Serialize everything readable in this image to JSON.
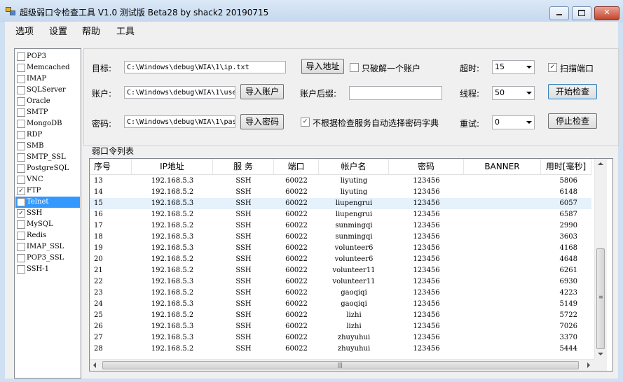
{
  "window": {
    "title": "超级弱口令检查工具 V1.0 测试版 Beta28 by shack2 20190715",
    "minimize_icon": "minimize-icon",
    "maximize_icon": "maximize-icon",
    "close_icon": "close-icon",
    "close_label": "✕"
  },
  "menu": [
    "选项",
    "设置",
    "帮助",
    "工具"
  ],
  "services": [
    {
      "name": "POP3",
      "checked": false
    },
    {
      "name": "Memcached",
      "checked": false
    },
    {
      "name": "IMAP",
      "checked": false
    },
    {
      "name": "SQLServer",
      "checked": false
    },
    {
      "name": "Oracle",
      "checked": false
    },
    {
      "name": "SMTP",
      "checked": false
    },
    {
      "name": "MongoDB",
      "checked": false
    },
    {
      "name": "RDP",
      "checked": false
    },
    {
      "name": "SMB",
      "checked": false
    },
    {
      "name": "SMTP_SSL",
      "checked": false
    },
    {
      "name": "PostgreSQL",
      "checked": false
    },
    {
      "name": "VNC",
      "checked": false
    },
    {
      "name": "FTP",
      "checked": true
    },
    {
      "name": "Telnet",
      "checked": false,
      "selected": true
    },
    {
      "name": "SSH",
      "checked": true
    },
    {
      "name": "MySQL",
      "checked": false
    },
    {
      "name": "Redis",
      "checked": false
    },
    {
      "name": "IMAP_SSL",
      "checked": false
    },
    {
      "name": "POP3_SSL",
      "checked": false
    },
    {
      "name": "SSH-1",
      "checked": false
    }
  ],
  "form": {
    "target_label": "目标:",
    "target_value": "C:\\Windows\\debug\\WIA\\1\\ip.txt",
    "import_address": "导入地址",
    "only_one_account": "只破解一个账户",
    "only_one_checked": false,
    "timeout_label": "超时:",
    "timeout_value": "15",
    "scan_port": "扫描端口",
    "scan_port_checked": true,
    "account_label": "账户:",
    "account_value": "C:\\Windows\\debug\\WIA\\1\\use",
    "import_account": "导入账户",
    "account_suffix_label": "账户后缀:",
    "account_suffix_value": "",
    "threads_label": "线程:",
    "threads_value": "50",
    "start_check": "开始检查",
    "password_label": "密码:",
    "password_value": "C:\\Windows\\debug\\WIA\\1\\pas",
    "import_password": "导入密码",
    "auto_dict": "不根据检查服务自动选择密码字典",
    "auto_dict_checked": true,
    "retry_label": "重试:",
    "retry_value": "0",
    "stop_check": "停止检查"
  },
  "list": {
    "title": "弱口令列表",
    "columns": [
      "序号",
      "IP地址",
      "服 务",
      "端口",
      "帐户名",
      "密码",
      "BANNER",
      "用时[毫秒]"
    ],
    "highlight_index": 2,
    "rows": [
      [
        "13",
        "192.168.5.3",
        "SSH",
        "60022",
        "liyuting",
        "123456",
        "",
        "5806"
      ],
      [
        "14",
        "192.168.5.2",
        "SSH",
        "60022",
        "liyuting",
        "123456",
        "",
        "6148"
      ],
      [
        "15",
        "192.168.5.3",
        "SSH",
        "60022",
        "liupengrui",
        "123456",
        "",
        "6057"
      ],
      [
        "16",
        "192.168.5.2",
        "SSH",
        "60022",
        "liupengrui",
        "123456",
        "",
        "6587"
      ],
      [
        "17",
        "192.168.5.2",
        "SSH",
        "60022",
        "sunmingqi",
        "123456",
        "",
        "2990"
      ],
      [
        "18",
        "192.168.5.3",
        "SSH",
        "60022",
        "sunmingqi",
        "123456",
        "",
        "3603"
      ],
      [
        "19",
        "192.168.5.3",
        "SSH",
        "60022",
        "volunteer6",
        "123456",
        "",
        "4168"
      ],
      [
        "20",
        "192.168.5.2",
        "SSH",
        "60022",
        "volunteer6",
        "123456",
        "",
        "4648"
      ],
      [
        "21",
        "192.168.5.2",
        "SSH",
        "60022",
        "volunteer11",
        "123456",
        "",
        "6261"
      ],
      [
        "22",
        "192.168.5.3",
        "SSH",
        "60022",
        "volunteer11",
        "123456",
        "",
        "6930"
      ],
      [
        "23",
        "192.168.5.2",
        "SSH",
        "60022",
        "gaoqiqi",
        "123456",
        "",
        "4223"
      ],
      [
        "24",
        "192.168.5.3",
        "SSH",
        "60022",
        "gaoqiqi",
        "123456",
        "",
        "5149"
      ],
      [
        "25",
        "192.168.5.2",
        "SSH",
        "60022",
        "lizhi",
        "123456",
        "",
        "5722"
      ],
      [
        "26",
        "192.168.5.3",
        "SSH",
        "60022",
        "lizhi",
        "123456",
        "",
        "7026"
      ],
      [
        "27",
        "192.168.5.3",
        "SSH",
        "60022",
        "zhuyuhui",
        "123456",
        "",
        "3370"
      ],
      [
        "28",
        "192.168.5.2",
        "SSH",
        "60022",
        "zhuyuhui",
        "123456",
        "",
        "5444"
      ]
    ]
  }
}
